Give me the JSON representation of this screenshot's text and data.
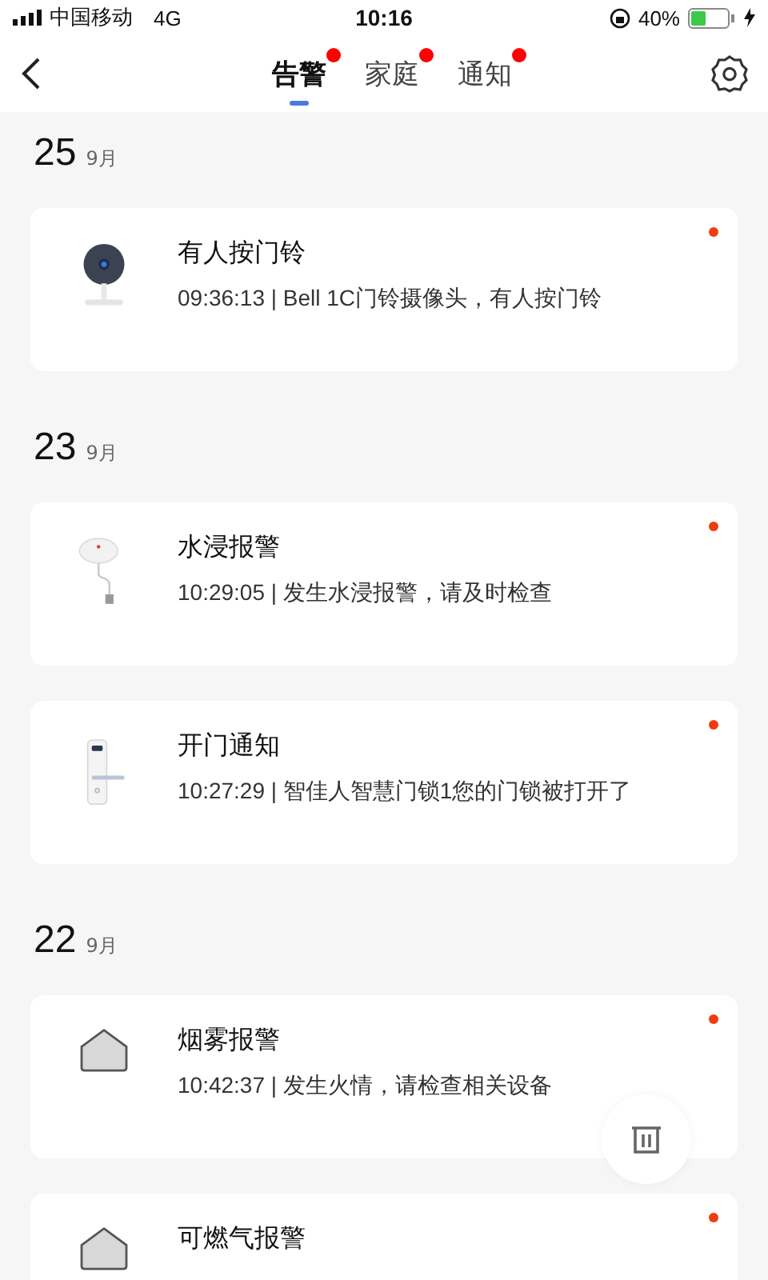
{
  "status_bar": {
    "carrier": "中国移动",
    "network": "4G",
    "time": "10:16",
    "battery": "40%"
  },
  "nav": {
    "tabs": [
      {
        "label": "告警",
        "selected": true,
        "badge": true
      },
      {
        "label": "家庭",
        "selected": false,
        "badge": true
      },
      {
        "label": "通知",
        "selected": false,
        "badge": true
      }
    ]
  },
  "groups": [
    {
      "day": "25",
      "month": "9月",
      "alerts": [
        {
          "kind": "camera",
          "title": "有人按门铃",
          "detail": "09:36:13 | Bell 1C门铃摄像头，有人按门铃",
          "unread": true
        }
      ]
    },
    {
      "day": "23",
      "month": "9月",
      "alerts": [
        {
          "kind": "water",
          "title": "水浸报警",
          "detail": "10:29:05 | 发生水浸报警，请及时检查",
          "unread": true
        },
        {
          "kind": "lock",
          "title": "开门通知",
          "detail": "10:27:29 | 智佳人智慧门锁1您的门锁被打开了",
          "unread": true
        }
      ]
    },
    {
      "day": "22",
      "month": "9月",
      "alerts": [
        {
          "kind": "house",
          "title": "烟雾报警",
          "detail": "10:42:37 | 发生火情，请检查相关设备",
          "unread": true
        },
        {
          "kind": "house",
          "title": "可燃气报警",
          "unread": true
        }
      ]
    }
  ]
}
